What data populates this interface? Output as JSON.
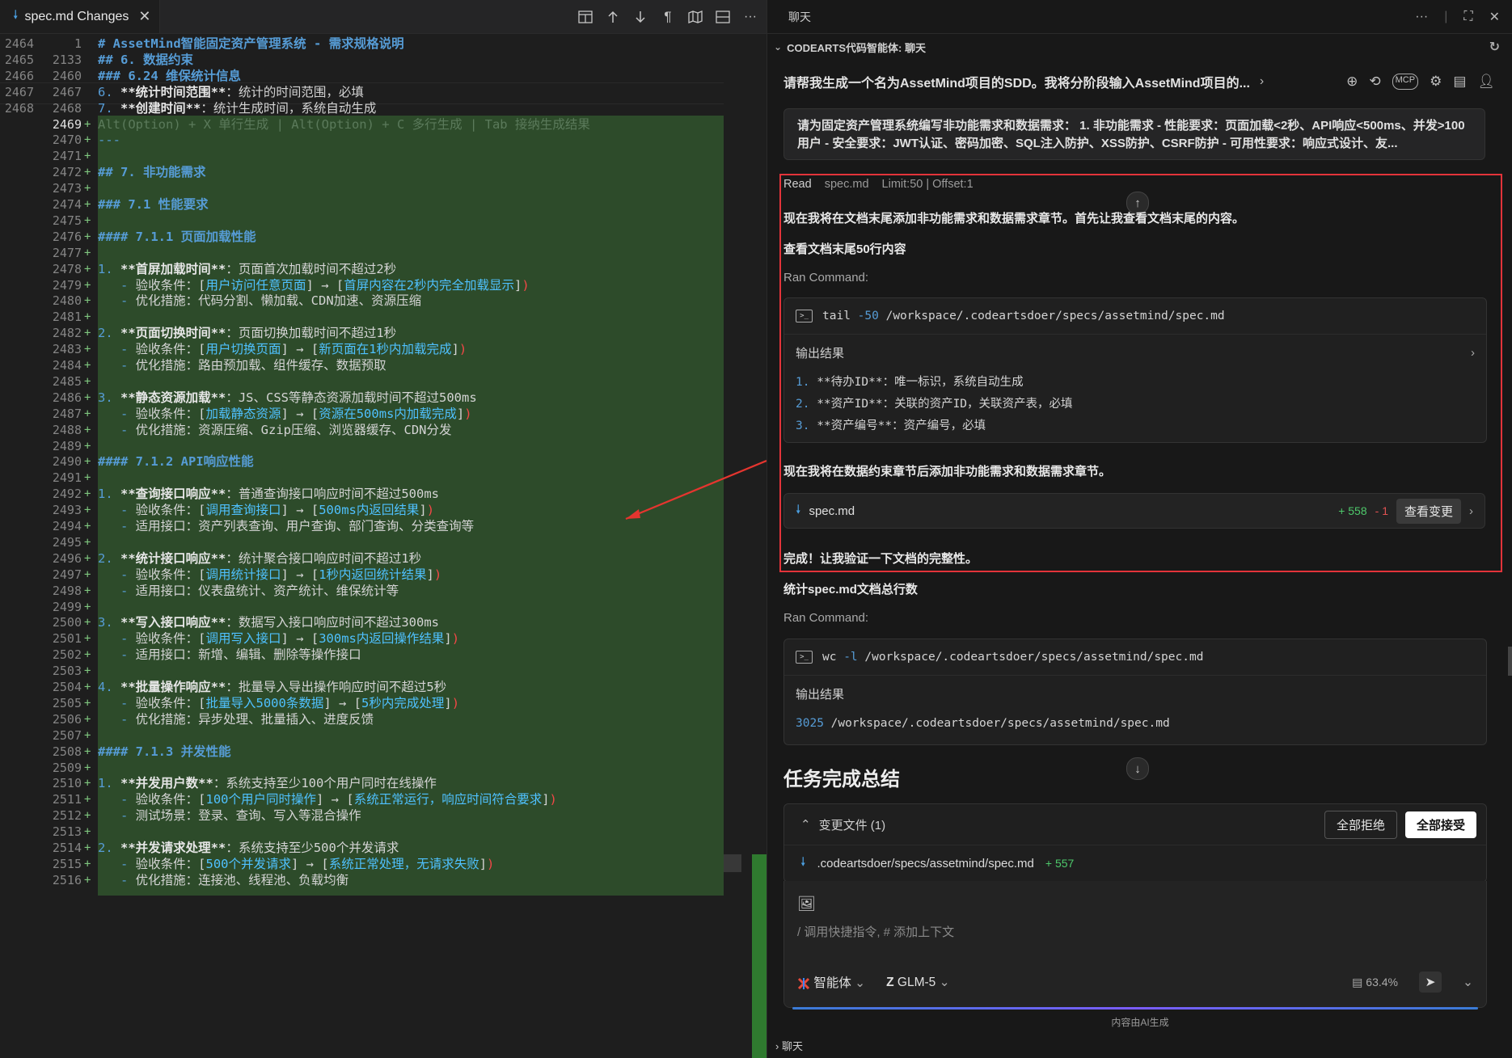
{
  "editor": {
    "tab_label": "spec.md Changes",
    "lines": [
      {
        "o": "2464",
        "n": "1",
        "segs": [
          [
            "h",
            "# AssetMind智能固定资产管理系统 - 需求规格说明"
          ]
        ]
      },
      {
        "o": "2465",
        "n": "2133",
        "segs": [
          [
            "h",
            "## 6. 数据约束"
          ]
        ]
      },
      {
        "o": "2466",
        "n": "2460",
        "segs": [
          [
            "h",
            "### 6.24 维保统计信息"
          ]
        ]
      },
      {
        "o": "2467",
        "n": "2467",
        "segs": [
          [
            "num",
            "6. "
          ],
          [
            "b",
            "**统计时间范围**"
          ],
          [
            "t",
            "：统计的时间范围，必填"
          ]
        ]
      },
      {
        "o": "2468",
        "n": "2468",
        "segs": [
          [
            "num",
            "7. "
          ],
          [
            "b",
            "**创建时间**"
          ],
          [
            "t",
            "：统计生成时间，系统自动生成"
          ]
        ]
      },
      {
        "o": "",
        "n": "2469",
        "add": true,
        "segs": [
          [
            "ghost",
            "Alt(Option) + X 单行生成 | Alt(Option) + C 多行生成 | Tab 接纳生成结果"
          ]
        ]
      },
      {
        "o": "",
        "n": "2470",
        "add": true,
        "segs": [
          [
            "dash",
            "---"
          ]
        ]
      },
      {
        "o": "",
        "n": "2471",
        "add": true,
        "segs": []
      },
      {
        "o": "",
        "n": "2472",
        "add": true,
        "segs": [
          [
            "h",
            "## 7. 非功能需求"
          ]
        ]
      },
      {
        "o": "",
        "n": "2473",
        "add": true,
        "segs": []
      },
      {
        "o": "",
        "n": "2474",
        "add": true,
        "segs": [
          [
            "h",
            "### 7.1 性能要求"
          ]
        ]
      },
      {
        "o": "",
        "n": "2475",
        "add": true,
        "segs": []
      },
      {
        "o": "",
        "n": "2476",
        "add": true,
        "segs": [
          [
            "h",
            "#### 7.1.1 页面加载性能"
          ]
        ]
      },
      {
        "o": "",
        "n": "2477",
        "add": true,
        "segs": []
      },
      {
        "o": "",
        "n": "2478",
        "add": true,
        "segs": [
          [
            "num",
            "1. "
          ],
          [
            "b",
            "**首屏加载时间**"
          ],
          [
            "t",
            "：页面首次加载时间不超过2秒"
          ]
        ]
      },
      {
        "o": "",
        "n": "2479",
        "add": true,
        "segs": [
          [
            "dash",
            "   - "
          ],
          [
            "t",
            "验收条件：["
          ],
          [
            "lk",
            "用户访问任意页面"
          ],
          [
            "t",
            "] → ["
          ],
          [
            "lk",
            "首屏内容在2秒内完全加载显示"
          ],
          [
            "t",
            "]"
          ],
          [
            "red",
            ")"
          ]
        ]
      },
      {
        "o": "",
        "n": "2480",
        "add": true,
        "segs": [
          [
            "dash",
            "   - "
          ],
          [
            "t",
            "优化措施：代码分割、懒加载、CDN加速、资源压缩"
          ]
        ]
      },
      {
        "o": "",
        "n": "2481",
        "add": true,
        "segs": []
      },
      {
        "o": "",
        "n": "2482",
        "add": true,
        "segs": [
          [
            "num",
            "2. "
          ],
          [
            "b",
            "**页面切换时间**"
          ],
          [
            "t",
            "：页面切换加载时间不超过1秒"
          ]
        ]
      },
      {
        "o": "",
        "n": "2483",
        "add": true,
        "segs": [
          [
            "dash",
            "   - "
          ],
          [
            "t",
            "验收条件：["
          ],
          [
            "lk",
            "用户切换页面"
          ],
          [
            "t",
            "] → ["
          ],
          [
            "lk",
            "新页面在1秒内加载完成"
          ],
          [
            "t",
            "]"
          ],
          [
            "red",
            ")"
          ]
        ]
      },
      {
        "o": "",
        "n": "2484",
        "add": true,
        "segs": [
          [
            "dash",
            "   - "
          ],
          [
            "t",
            "优化措施：路由预加载、组件缓存、数据预取"
          ]
        ]
      },
      {
        "o": "",
        "n": "2485",
        "add": true,
        "segs": []
      },
      {
        "o": "",
        "n": "2486",
        "add": true,
        "segs": [
          [
            "num",
            "3. "
          ],
          [
            "b",
            "**静态资源加载**"
          ],
          [
            "t",
            "：JS、CSS等静态资源加载时间不超过500ms"
          ]
        ]
      },
      {
        "o": "",
        "n": "2487",
        "add": true,
        "segs": [
          [
            "dash",
            "   - "
          ],
          [
            "t",
            "验收条件：["
          ],
          [
            "lk",
            "加载静态资源"
          ],
          [
            "t",
            "] → ["
          ],
          [
            "lk",
            "资源在500ms内加载完成"
          ],
          [
            "t",
            "]"
          ],
          [
            "red",
            ")"
          ]
        ]
      },
      {
        "o": "",
        "n": "2488",
        "add": true,
        "segs": [
          [
            "dash",
            "   - "
          ],
          [
            "t",
            "优化措施：资源压缩、Gzip压缩、浏览器缓存、CDN分发"
          ]
        ]
      },
      {
        "o": "",
        "n": "2489",
        "add": true,
        "segs": []
      },
      {
        "o": "",
        "n": "2490",
        "add": true,
        "segs": [
          [
            "h",
            "#### 7.1.2 API响应性能"
          ]
        ]
      },
      {
        "o": "",
        "n": "2491",
        "add": true,
        "segs": []
      },
      {
        "o": "",
        "n": "2492",
        "add": true,
        "segs": [
          [
            "num",
            "1. "
          ],
          [
            "b",
            "**查询接口响应**"
          ],
          [
            "t",
            "：普通查询接口响应时间不超过500ms"
          ]
        ]
      },
      {
        "o": "",
        "n": "2493",
        "add": true,
        "segs": [
          [
            "dash",
            "   - "
          ],
          [
            "t",
            "验收条件：["
          ],
          [
            "lk",
            "调用查询接口"
          ],
          [
            "t",
            "] → ["
          ],
          [
            "lk",
            "500ms内返回结果"
          ],
          [
            "t",
            "]"
          ],
          [
            "red",
            ")"
          ]
        ]
      },
      {
        "o": "",
        "n": "2494",
        "add": true,
        "segs": [
          [
            "dash",
            "   - "
          ],
          [
            "t",
            "适用接口：资产列表查询、用户查询、部门查询、分类查询等"
          ]
        ]
      },
      {
        "o": "",
        "n": "2495",
        "add": true,
        "segs": []
      },
      {
        "o": "",
        "n": "2496",
        "add": true,
        "segs": [
          [
            "num",
            "2. "
          ],
          [
            "b",
            "**统计接口响应**"
          ],
          [
            "t",
            "：统计聚合接口响应时间不超过1秒"
          ]
        ]
      },
      {
        "o": "",
        "n": "2497",
        "add": true,
        "segs": [
          [
            "dash",
            "   - "
          ],
          [
            "t",
            "验收条件：["
          ],
          [
            "lk",
            "调用统计接口"
          ],
          [
            "t",
            "] → ["
          ],
          [
            "lk",
            "1秒内返回统计结果"
          ],
          [
            "t",
            "]"
          ],
          [
            "red",
            ")"
          ]
        ]
      },
      {
        "o": "",
        "n": "2498",
        "add": true,
        "segs": [
          [
            "dash",
            "   - "
          ],
          [
            "t",
            "适用接口：仪表盘统计、资产统计、维保统计等"
          ]
        ]
      },
      {
        "o": "",
        "n": "2499",
        "add": true,
        "segs": []
      },
      {
        "o": "",
        "n": "2500",
        "add": true,
        "segs": [
          [
            "num",
            "3. "
          ],
          [
            "b",
            "**写入接口响应**"
          ],
          [
            "t",
            "：数据写入接口响应时间不超过300ms"
          ]
        ]
      },
      {
        "o": "",
        "n": "2501",
        "add": true,
        "segs": [
          [
            "dash",
            "   - "
          ],
          [
            "t",
            "验收条件：["
          ],
          [
            "lk",
            "调用写入接口"
          ],
          [
            "t",
            "] → ["
          ],
          [
            "lk",
            "300ms内返回操作结果"
          ],
          [
            "t",
            "]"
          ],
          [
            "red",
            ")"
          ]
        ]
      },
      {
        "o": "",
        "n": "2502",
        "add": true,
        "segs": [
          [
            "dash",
            "   - "
          ],
          [
            "t",
            "适用接口：新增、编辑、删除等操作接口"
          ]
        ]
      },
      {
        "o": "",
        "n": "2503",
        "add": true,
        "segs": []
      },
      {
        "o": "",
        "n": "2504",
        "add": true,
        "segs": [
          [
            "num",
            "4. "
          ],
          [
            "b",
            "**批量操作响应**"
          ],
          [
            "t",
            "：批量导入导出操作响应时间不超过5秒"
          ]
        ]
      },
      {
        "o": "",
        "n": "2505",
        "add": true,
        "segs": [
          [
            "dash",
            "   - "
          ],
          [
            "t",
            "验收条件：["
          ],
          [
            "lk",
            "批量导入5000条数据"
          ],
          [
            "t",
            "] → ["
          ],
          [
            "lk",
            "5秒内完成处理"
          ],
          [
            "t",
            "]"
          ],
          [
            "red",
            ")"
          ]
        ]
      },
      {
        "o": "",
        "n": "2506",
        "add": true,
        "segs": [
          [
            "dash",
            "   - "
          ],
          [
            "t",
            "优化措施：异步处理、批量插入、进度反馈"
          ]
        ]
      },
      {
        "o": "",
        "n": "2507",
        "add": true,
        "segs": []
      },
      {
        "o": "",
        "n": "2508",
        "add": true,
        "segs": [
          [
            "h",
            "#### 7.1.3 并发性能"
          ]
        ]
      },
      {
        "o": "",
        "n": "2509",
        "add": true,
        "segs": []
      },
      {
        "o": "",
        "n": "2510",
        "add": true,
        "segs": [
          [
            "num",
            "1. "
          ],
          [
            "b",
            "**并发用户数**"
          ],
          [
            "t",
            "：系统支持至少100个用户同时在线操作"
          ]
        ]
      },
      {
        "o": "",
        "n": "2511",
        "add": true,
        "segs": [
          [
            "dash",
            "   - "
          ],
          [
            "t",
            "验收条件：["
          ],
          [
            "lk",
            "100个用户同时操作"
          ],
          [
            "t",
            "] → ["
          ],
          [
            "lk",
            "系统正常运行，响应时间符合要求"
          ],
          [
            "t",
            "]"
          ],
          [
            "red",
            ")"
          ]
        ]
      },
      {
        "o": "",
        "n": "2512",
        "add": true,
        "segs": [
          [
            "dash",
            "   - "
          ],
          [
            "t",
            "测试场景：登录、查询、写入等混合操作"
          ]
        ]
      },
      {
        "o": "",
        "n": "2513",
        "add": true,
        "segs": []
      },
      {
        "o": "",
        "n": "2514",
        "add": true,
        "segs": [
          [
            "num",
            "2. "
          ],
          [
            "b",
            "**并发请求处理**"
          ],
          [
            "t",
            "：系统支持至少500个并发请求"
          ]
        ]
      },
      {
        "o": "",
        "n": "2515",
        "add": true,
        "segs": [
          [
            "dash",
            "   - "
          ],
          [
            "t",
            "验收条件：["
          ],
          [
            "lk",
            "500个并发请求"
          ],
          [
            "t",
            "] → ["
          ],
          [
            "lk",
            "系统正常处理，无请求失败"
          ],
          [
            "t",
            "]"
          ],
          [
            "red",
            ")"
          ]
        ]
      },
      {
        "o": "",
        "n": "2516",
        "add": true,
        "segs": [
          [
            "dash",
            "   - "
          ],
          [
            "t",
            "优化措施：连接池、线程池、负载均衡"
          ]
        ]
      }
    ]
  },
  "chat": {
    "panel_title": "聊天",
    "agent_title": "CODEARTS代码智能体: 聊天",
    "request_title": "请帮我生成一个名为AssetMind项目的SDD。我将分阶段输入AssetMind项目的...",
    "request_text": "请为固定资产管理系统编写非功能需求和数据需求： 1. 非功能需求 - 性能要求：页面加载<2秒、API响应<500ms、并发>100用户 - 安全要求：JWT认证、密码加密、SQL注入防护、XSS防护、CSRF防护 - 可用性要求：响应式设计、友...",
    "read_label": "Read",
    "read_file": "spec.md",
    "read_params": "Limit:50 | Offset:1",
    "msg1": "现在我将在文档末尾添加非功能需求和数据需求章节。首先让我查看文档末尾的内容。",
    "msg2": "查看文档末尾50行内容",
    "ran_command": "Ran Command:",
    "cmd1": {
      "cmd": "tail",
      "flag": "-50",
      "path": "/workspace/.codeartsdoer/specs/assetmind/spec.md"
    },
    "output_label": "输出结果",
    "out1": [
      {
        "n": "1.",
        "text": "**待办ID**：唯一标识，系统自动生成"
      },
      {
        "n": "2.",
        "text": "**资产ID**：关联的资产ID，关联资产表，必填"
      },
      {
        "n": "3.",
        "text": "**资产编号**：资产编号，必填"
      }
    ],
    "msg3": "现在我将在数据约束章节后添加非功能需求和数据需求章节。",
    "file_card": {
      "name": "spec.md",
      "plus": "+ 558",
      "minus": "- 1",
      "view": "查看变更"
    },
    "msg4": "完成！让我验证一下文档的完整性。",
    "msg5": "统计spec.md文档总行数",
    "ran_command2": "Ran Command:",
    "cmd2": {
      "cmd": "wc",
      "flag": "-l",
      "path": "/workspace/.codeartsdoer/specs/assetmind/spec.md"
    },
    "out2": "3025 /workspace/.codeartsdoer/specs/assetmind/spec.md",
    "summary_title": "任务完成总结",
    "changes_label": "变更文件 (1)",
    "reject_all": "全部拒绝",
    "accept_all": "全部接受",
    "changed_file": ".codeartsdoer/specs/assetmind/spec.md",
    "changed_plus": "+ 557",
    "input_placeholder": "/ 调用快捷指令, # 添加上下文",
    "agent_mode": "智能体",
    "model": "GLM-5",
    "context_usage": "63.4%",
    "ai_note": "内容由AI生成",
    "footer": "聊天"
  }
}
